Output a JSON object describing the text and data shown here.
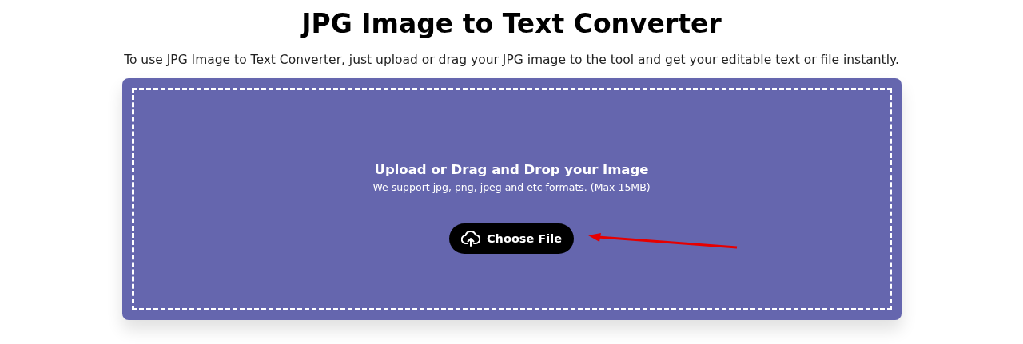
{
  "title": "JPG Image to Text Converter",
  "subtitle": "To use JPG Image to Text Converter, just upload or drag your JPG image to the tool and get your editable text or file instantly.",
  "dropzone": {
    "heading": "Upload or Drag and Drop your Image",
    "note": "We support jpg, png, jpeg and etc formats. (Max 15MB)",
    "button": "Choose File"
  }
}
